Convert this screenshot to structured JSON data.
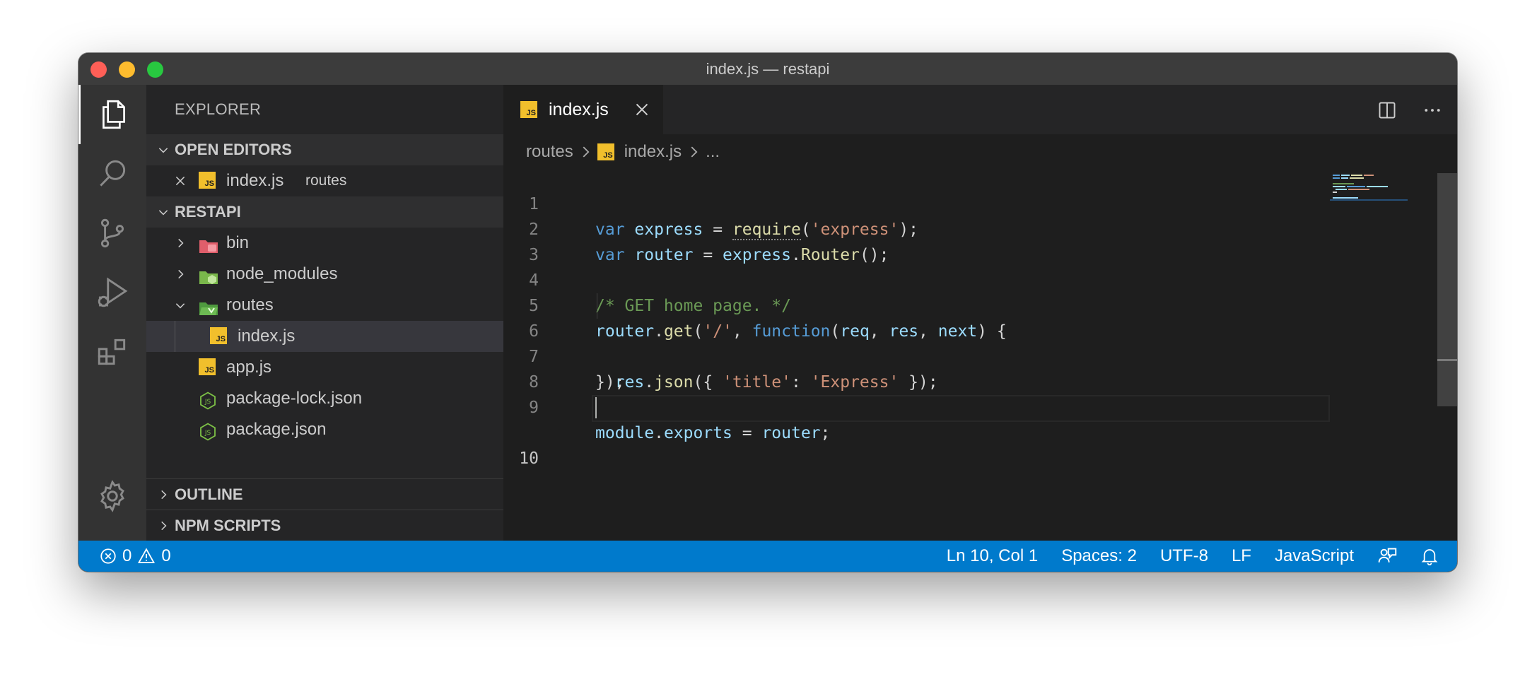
{
  "window": {
    "title": "index.js — restapi"
  },
  "activity_bar": {
    "items": [
      "files-icon",
      "search-icon",
      "source-control-icon",
      "run-debug-icon",
      "extensions-icon"
    ],
    "bottom": "gear-icon"
  },
  "sidebar": {
    "title": "EXPLORER",
    "open_editors": {
      "header": "OPEN EDITORS",
      "items": [
        {
          "name": "index.js",
          "folder": "routes"
        }
      ]
    },
    "project": {
      "header": "RESTAPI",
      "items": [
        {
          "name": "bin",
          "type": "folder"
        },
        {
          "name": "node_modules",
          "type": "folder"
        },
        {
          "name": "routes",
          "type": "folder",
          "expanded": true
        },
        {
          "name": "index.js",
          "type": "js",
          "selected": true
        },
        {
          "name": "app.js",
          "type": "js"
        },
        {
          "name": "package-lock.json",
          "type": "json"
        },
        {
          "name": "package.json",
          "type": "json"
        }
      ]
    },
    "outline": "OUTLINE",
    "npm_scripts": "NPM SCRIPTS"
  },
  "editor": {
    "tab": {
      "label": "index.js"
    },
    "breadcrumb": {
      "folder": "routes",
      "file": "index.js",
      "more": "..."
    },
    "line_numbers": [
      "1",
      "2",
      "3",
      "4",
      "5",
      "6",
      "7",
      "8",
      "9",
      "10"
    ],
    "current_line": 10
  },
  "status_bar": {
    "errors": "0",
    "warnings": "0",
    "position": "Ln 10, Col 1",
    "spaces": "Spaces: 2",
    "encoding": "UTF-8",
    "eol": "LF",
    "language": "JavaScript"
  },
  "colors": {
    "status_bar": "#007acc",
    "js_badge": "#f1bf2c",
    "keyword": "#569cd6",
    "string": "#ce9178",
    "comment": "#6a9955"
  }
}
